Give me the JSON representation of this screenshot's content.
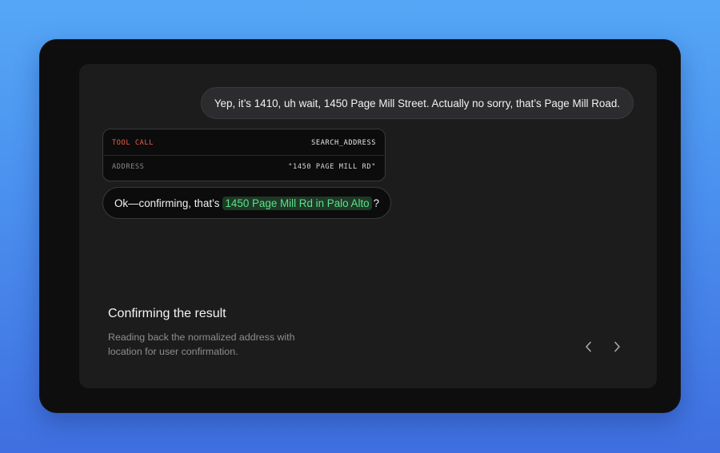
{
  "conversation": {
    "user_message": "Yep, it’s 1410, uh wait, 1450 Page Mill Street. Actually no sorry, that’s Page Mill Road.",
    "tool_call": {
      "label": "TOOL CALL",
      "name": "SEARCH_ADDRESS",
      "param_key": "ADDRESS",
      "param_value": "\"1450 PAGE MILL RD\""
    },
    "agent_reply": {
      "prefix": "Ok—confirming, that’s",
      "highlight": "1450 Page Mill Rd in Palo Alto",
      "suffix": "?"
    }
  },
  "caption": {
    "title": "Confirming the result",
    "body": "Reading back the normalized address with location for user confirmation."
  },
  "nav": {
    "prev_icon": "chevron-left-icon",
    "next_icon": "chevron-right-icon"
  },
  "colors": {
    "tool_call_label": "#e8604a",
    "highlight_text": "#5ee08a",
    "highlight_bg": "#1d3a26",
    "background_top": "#55a7f6",
    "background_bottom": "#3f6fe0"
  }
}
